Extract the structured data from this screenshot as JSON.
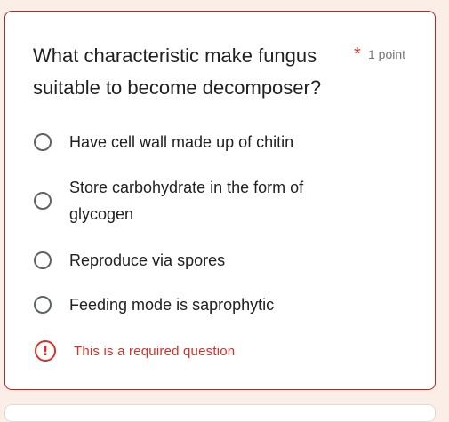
{
  "question": {
    "title": "What characteristic make fungus suitable to become decomposer?",
    "required_marker": "*",
    "points": "1 point"
  },
  "options": [
    {
      "label": "Have cell wall made up of chitin"
    },
    {
      "label": "Store carbohydrate in the form of glycogen"
    },
    {
      "label": "Reproduce via spores"
    },
    {
      "label": "Feeding mode is saprophytic"
    }
  ],
  "error": {
    "icon": "exclamation-icon",
    "icon_glyph": "!",
    "message": "This is a required question"
  },
  "colors": {
    "error": "#d93025",
    "page_background": "#fbeee6"
  }
}
